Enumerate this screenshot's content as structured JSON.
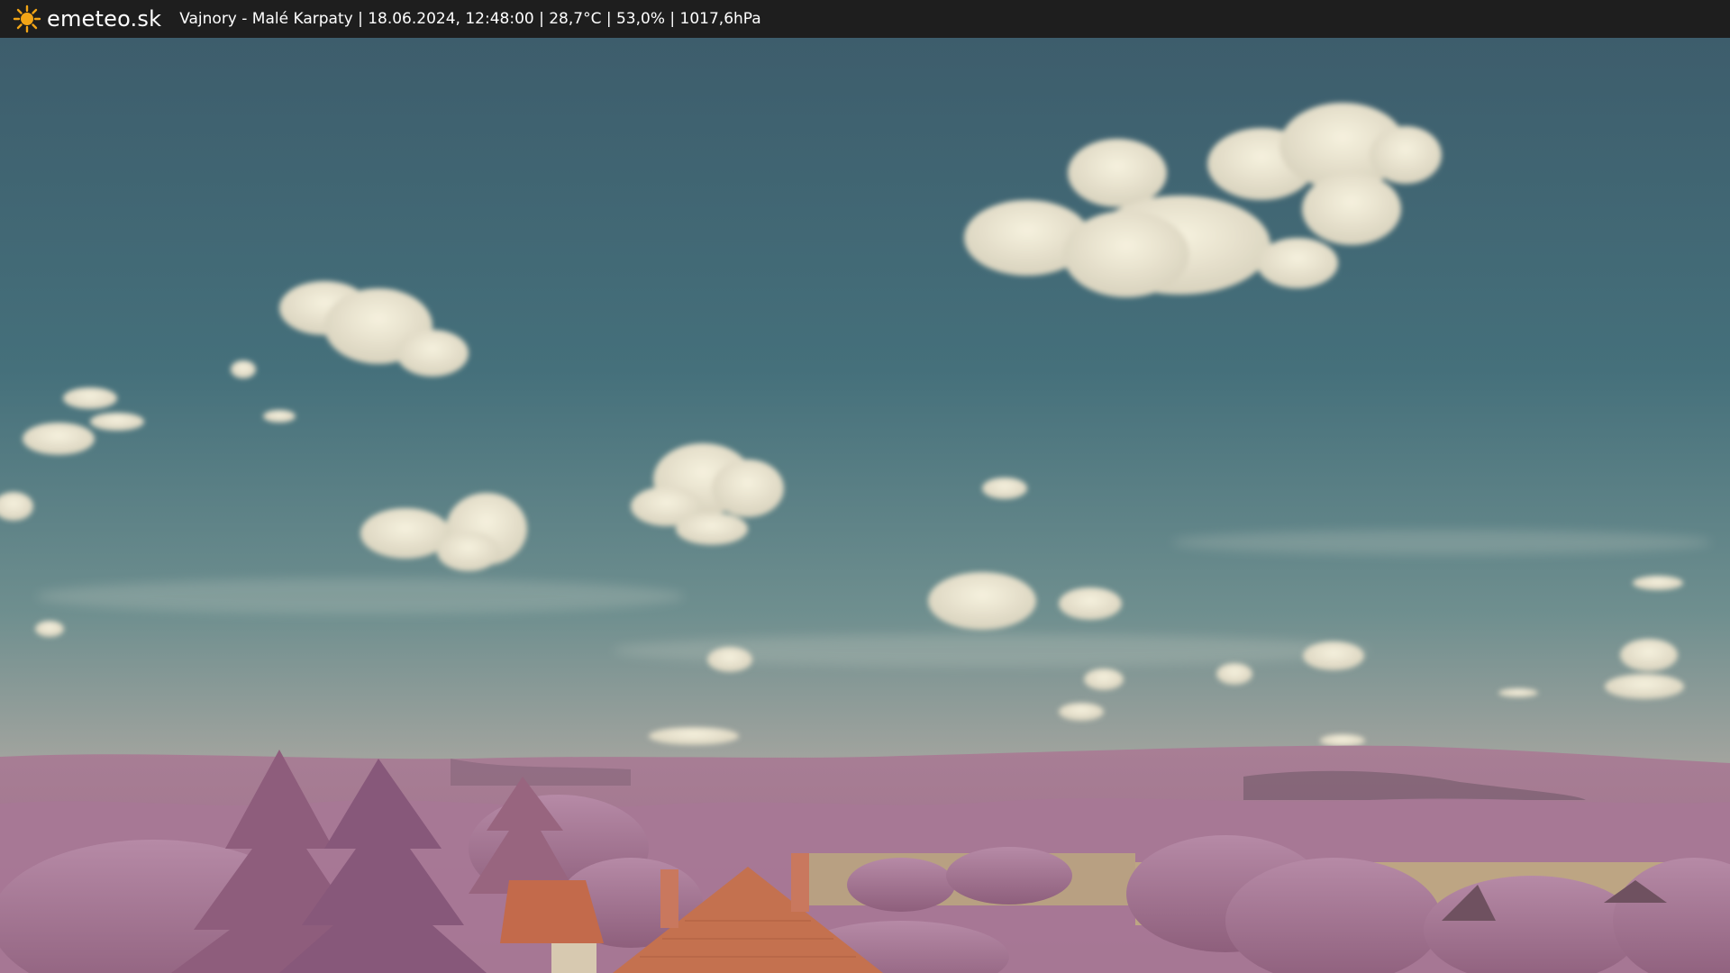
{
  "overlay": {
    "brand_name": "emeteo.sk",
    "status": "Vajnory - Malé Karpaty | 18.06.2024, 12:48:00 | 28,7°C | 53,0% | 1017,6hPa",
    "icon": "sun-icon",
    "icon_color": "#f2a516",
    "background": "#1e1e1e"
  },
  "scene": {
    "subject": "webcam-sky-landscape",
    "sky_color_top": "#3f5f6e",
    "sky_color_horizon": "#8c9f9c",
    "vegetation_color": "#b07f9c",
    "roof_color": "#c46b4e"
  }
}
